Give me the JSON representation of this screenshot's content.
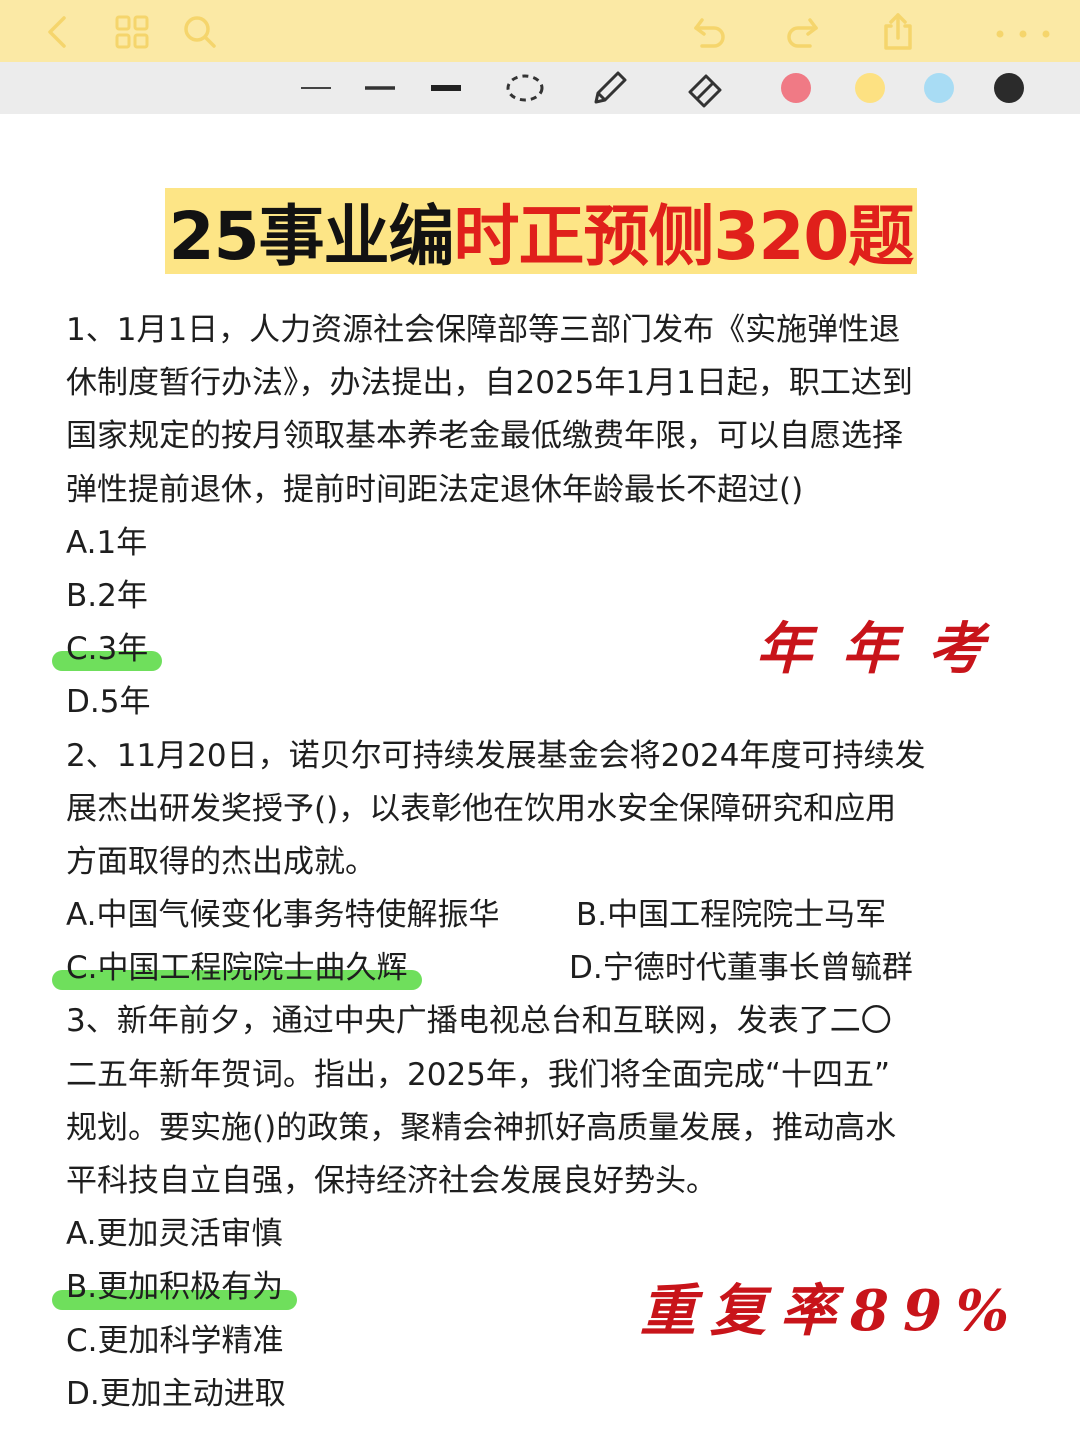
{
  "topbar": {
    "icons": [
      "back-icon",
      "grid-icon",
      "search-icon",
      "undo-icon",
      "redo-icon",
      "share-icon",
      "more-icon"
    ]
  },
  "toolbar": {
    "tools": [
      "line-thin-icon",
      "line-medium-icon",
      "line-thick-icon",
      "lasso-icon",
      "pencil-icon",
      "eraser-icon"
    ],
    "colors": [
      "#f07a85",
      "#fde182",
      "#a8dcf4",
      "#2b2b2b"
    ]
  },
  "title": {
    "black_part": "25事业编",
    "red_part": "时正预侧320题"
  },
  "questions": {
    "q1": {
      "lines": [
        "1、1月1日，人力资源社会保障部等三部门发布《实施弹性退",
        "休制度暂行办法》，办法提出，自2025年1月1日起，职工达到",
        "国家规定的按月领取基本养老金最低缴费年限，可以自愿选择",
        "弹性提前退休，提前时间距法定退休年龄最长不超过()"
      ],
      "options": [
        "A.1年",
        "B.2年",
        "C.3年",
        "D.5年"
      ]
    },
    "q2": {
      "lines": [
        "2、11月20日，诺贝尔可持续发展基金会将2024年度可持续发",
        "展杰出研发奖授予()，以表彰他在饮用水安全保障研究和应用",
        "方面取得的杰出成就。"
      ],
      "options": [
        "A.中国气候变化事务特使解振华",
        "B.中国工程院院士马军",
        "C.中国工程院院士曲久辉",
        "D.宁德时代董事长曾毓群"
      ]
    },
    "q3": {
      "lines": [
        "3、新年前夕，通过中央广播电视总台和互联网，发表了二〇",
        "二五年新年贺词。指出，2025年，我们将全面完成“十四五”",
        "规划。要实施()的政策，聚精会神抓好高质量发展，推动高水",
        "平科技自立自强，保持经济社会发展良好势头。"
      ],
      "options": [
        "A.更加灵活审慎",
        "B.更加积极有为",
        "C.更加科学精准",
        "D.更加主动进取"
      ]
    }
  },
  "annotations": {
    "note1": "年年考",
    "note2": "重复率89%"
  },
  "colors": {
    "title_red": "#e0201b",
    "highlight_green": "#5fdc4a",
    "annotation_red": "#c8141a",
    "topbar_yellow": "#fbe9a5"
  }
}
